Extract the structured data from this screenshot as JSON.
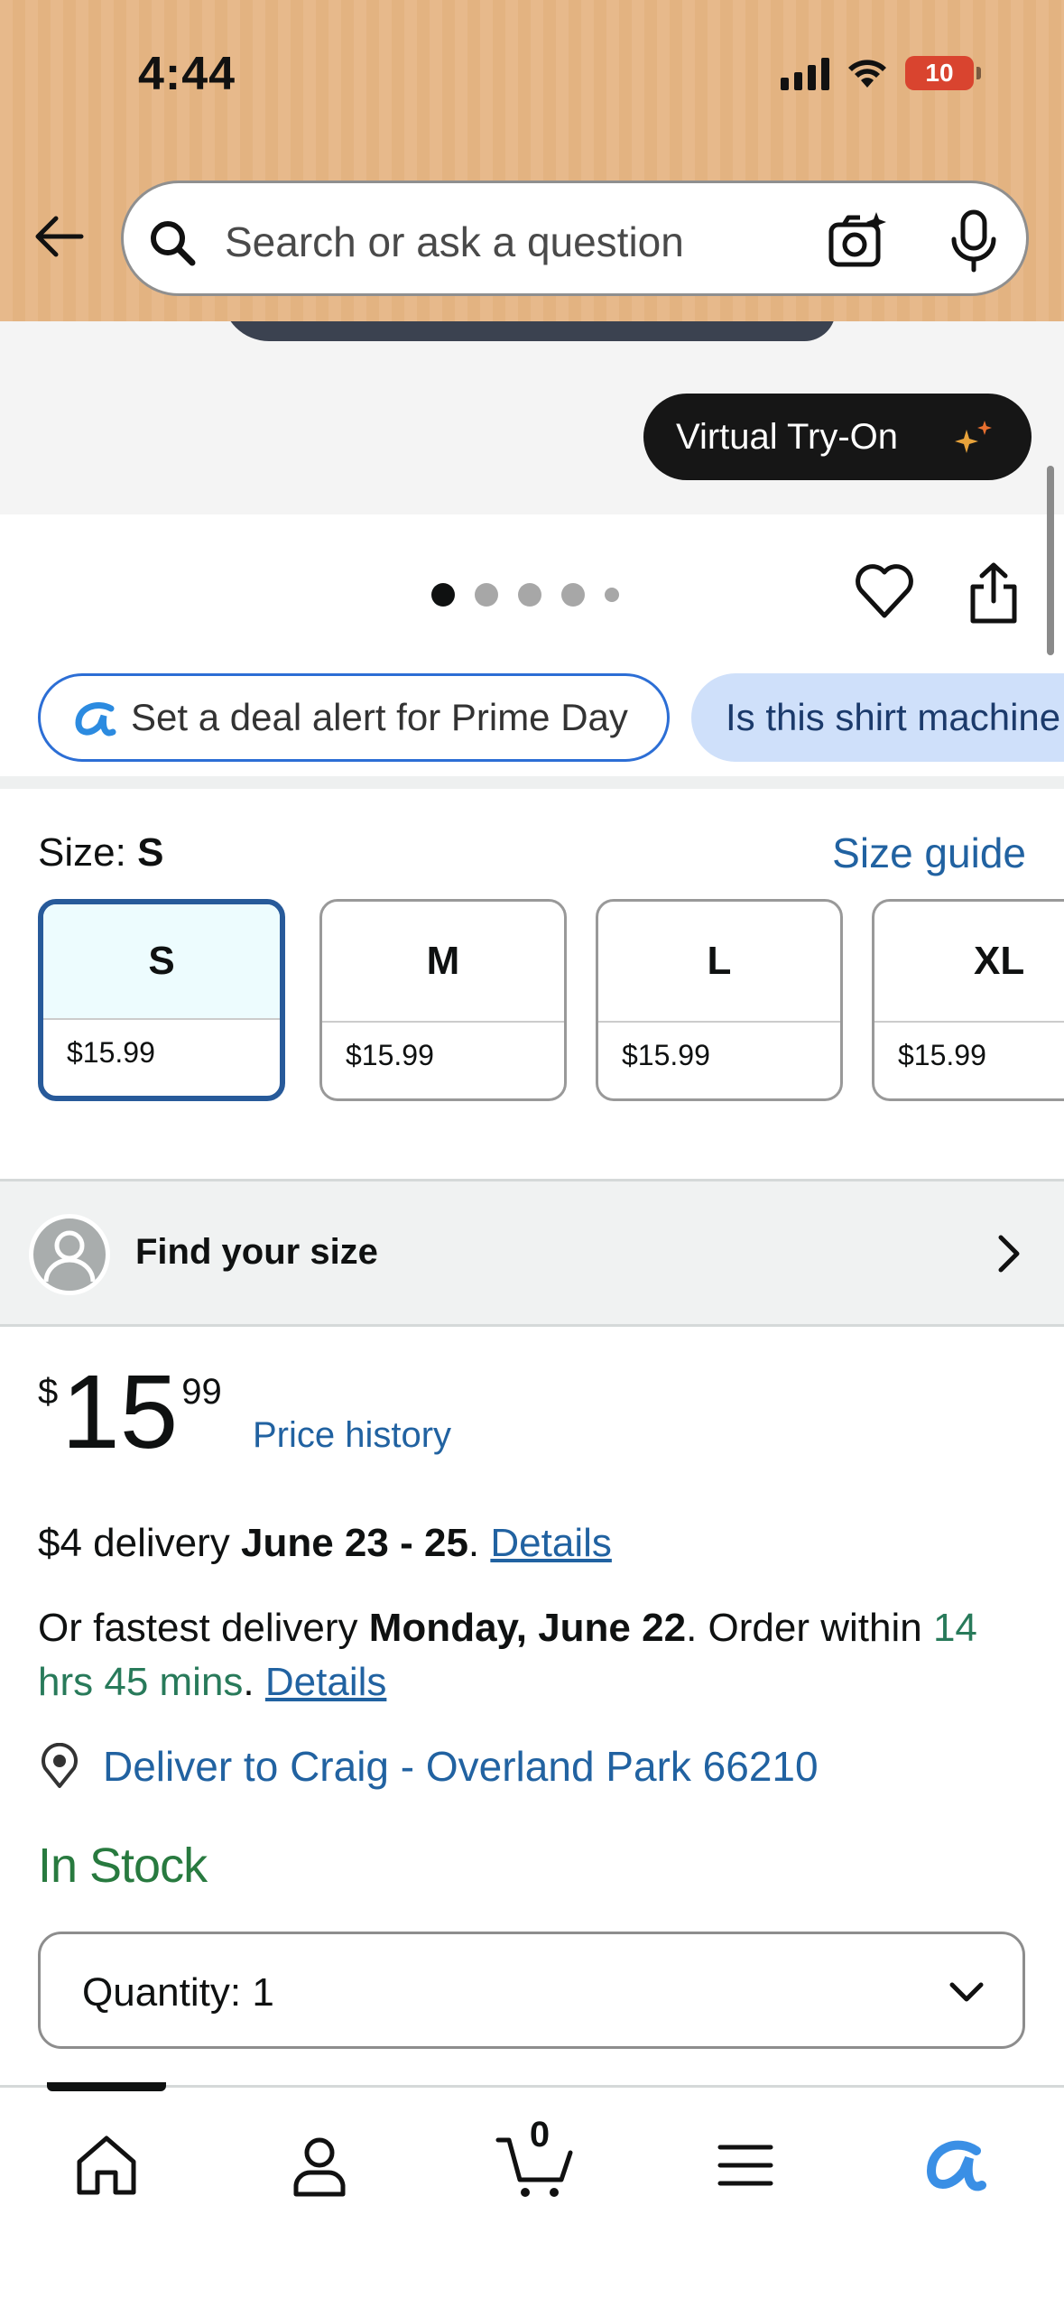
{
  "status_bar": {
    "time": "4:44",
    "battery": "10"
  },
  "search": {
    "placeholder": "Search or ask a question"
  },
  "image_overlay": {
    "virtual_try_on": "Virtual Try-On"
  },
  "carousel": {
    "total_dots": 5,
    "active_index": 0
  },
  "chips": {
    "deal_alert": "Set a deal alert for Prime Day",
    "question": "Is this shirt machine washable?"
  },
  "size": {
    "label": "Size:",
    "selected": "S",
    "guide": "Size guide",
    "options": [
      {
        "size": "S",
        "price": "$15.99"
      },
      {
        "size": "M",
        "price": "$15.99"
      },
      {
        "size": "L",
        "price": "$15.99"
      },
      {
        "size": "XL",
        "price": "$15.99"
      }
    ]
  },
  "find_your_size": {
    "label": "Find your size"
  },
  "price": {
    "symbol": "$",
    "whole": "15",
    "fraction": "99",
    "history_link": "Price history"
  },
  "delivery": {
    "standard_prefix": "$4 delivery ",
    "standard_dates": "June 23 - 25",
    "standard_sep": ". ",
    "details_label": "Details",
    "fastest_prefix": "Or fastest delivery ",
    "fastest_date": "Monday, June 22",
    "fastest_mid": ". Order within ",
    "countdown": "14 hrs 45 mins",
    "fastest_sep": ". ",
    "location": "Deliver to Craig - Overland Park 66210"
  },
  "stock_status": "In Stock",
  "quantity": {
    "label": "Quantity:",
    "value": "1"
  },
  "bottom_nav": {
    "cart_count": "0"
  },
  "colors": {
    "link": "#2162a1",
    "in_stock": "#287a3f",
    "countdown": "#287a5a",
    "selected_size_border": "#275a9a",
    "header_bg": "#e7b98b",
    "question_chip_bg": "#cfe0fa"
  },
  "icons": [
    "back-arrow-icon",
    "search-icon",
    "camera-icon",
    "mic-icon",
    "sparkle-icon",
    "heart-icon",
    "share-icon",
    "rufus-icon",
    "avatar-icon",
    "chevron-right-icon",
    "location-pin-icon",
    "chevron-down-icon",
    "home-icon",
    "account-icon",
    "cart-icon",
    "menu-icon"
  ]
}
